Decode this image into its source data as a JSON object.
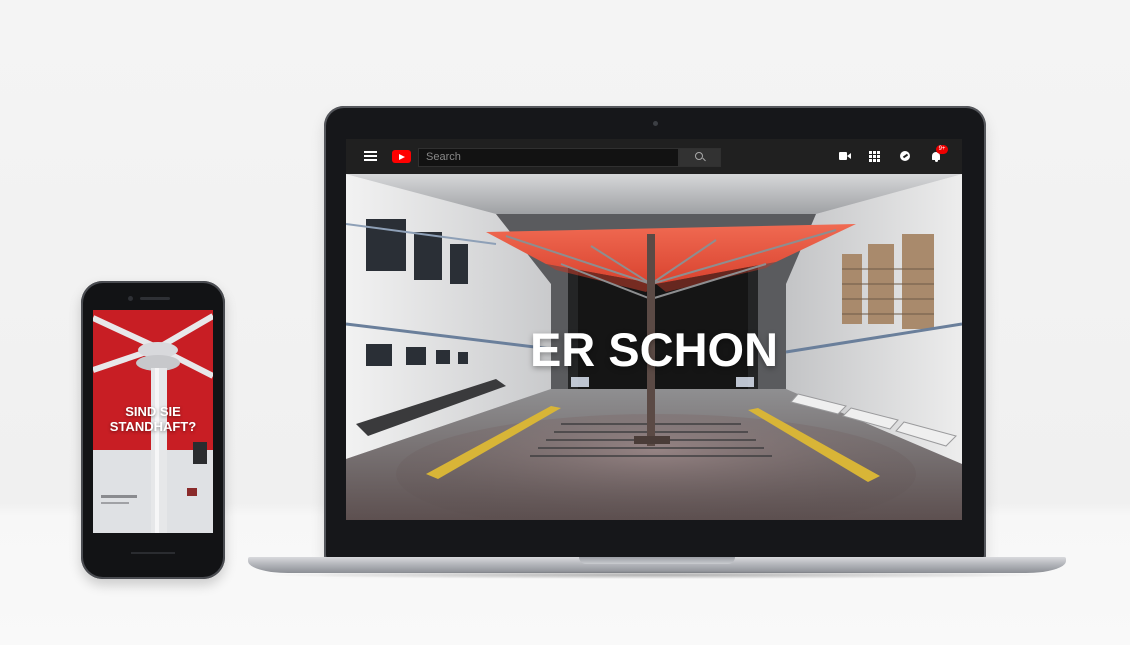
{
  "laptop": {
    "youtube": {
      "search": {
        "placeholder": "Search"
      },
      "notifications_badge": "9+",
      "icons": {
        "menu": "hamburger-menu-icon",
        "logo": "youtube-logo-icon",
        "search": "search-icon",
        "create": "video-camera-icon",
        "apps": "apps-grid-icon",
        "messages": "chat-bubble-icon",
        "notifications": "bell-icon"
      }
    },
    "video": {
      "overlay_text": "ER SCHON"
    }
  },
  "phone": {
    "overlay_line1": "SIND SIE",
    "overlay_line2": "STANDHAFT?"
  },
  "colors": {
    "youtube_red": "#ff0000",
    "topbar_bg": "#202020",
    "umbrella_red": "#e8503d",
    "phone_red": "#c81e24"
  }
}
